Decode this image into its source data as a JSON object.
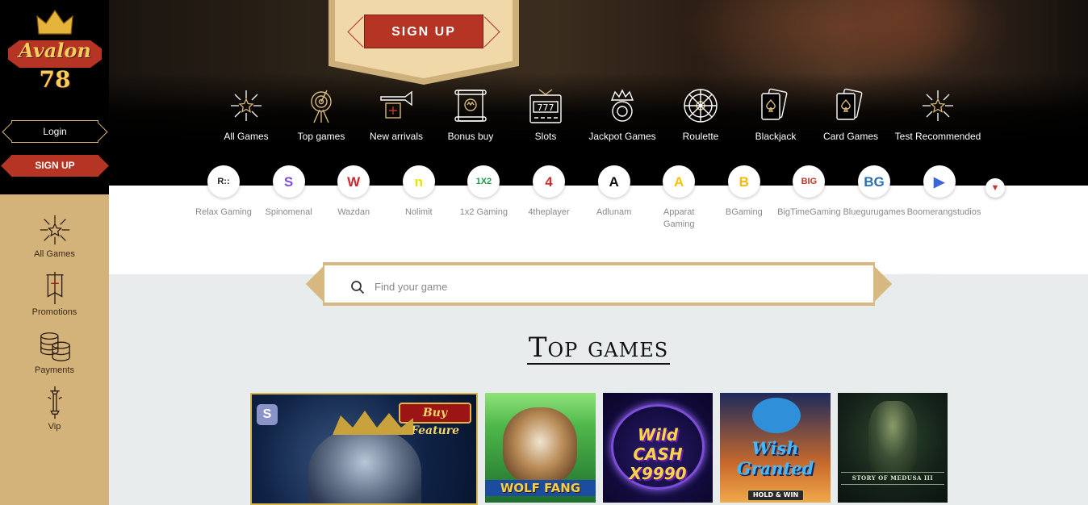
{
  "brand": {
    "name": "Avalon",
    "number": "78"
  },
  "auth": {
    "login_label": "Login",
    "signup_label": "SIGN UP",
    "hero_signup_label": "SIGN UP"
  },
  "sidebar": {
    "items": [
      {
        "label": "All Games",
        "icon": "fireworks-icon"
      },
      {
        "label": "Promotions",
        "icon": "banner-flag-icon"
      },
      {
        "label": "Payments",
        "icon": "coins-icon"
      },
      {
        "label": "Vip",
        "icon": "sword-icon"
      }
    ]
  },
  "categories": [
    {
      "label": "All Games",
      "icon": "fireworks-icon"
    },
    {
      "label": "Top games",
      "icon": "target-icon"
    },
    {
      "label": "New arrivals",
      "icon": "trumpet-icon"
    },
    {
      "label": "Bonus buy",
      "icon": "scroll-icon"
    },
    {
      "label": "Slots",
      "icon": "slot-machine-icon"
    },
    {
      "label": "Jackpot Games",
      "icon": "crown-ring-icon"
    },
    {
      "label": "Roulette",
      "icon": "roulette-icon"
    },
    {
      "label": "Blackjack",
      "icon": "cards-icon"
    },
    {
      "label": "Card Games",
      "icon": "cards-icon"
    },
    {
      "label": "Test Recommended",
      "icon": "fireworks-icon"
    }
  ],
  "providers": [
    {
      "label": "Relax Gaming",
      "mark": "R::",
      "color": "#222222"
    },
    {
      "label": "Spinomenal",
      "mark": "S",
      "color": "#7b4de0"
    },
    {
      "label": "Wazdan",
      "mark": "W",
      "color": "#d0282e"
    },
    {
      "label": "Nolimit",
      "mark": "n",
      "color": "#e6e600"
    },
    {
      "label": "1x2 Gaming",
      "mark": "1X2",
      "color": "#1f9e4a"
    },
    {
      "label": "4theplayer",
      "mark": "4",
      "color": "#d22d2d"
    },
    {
      "label": "Adlunam",
      "mark": "A",
      "color": "#111111"
    },
    {
      "label": "Apparat Gaming",
      "mark": "A",
      "color": "#f5c400"
    },
    {
      "label": "BGaming",
      "mark": "B",
      "color": "#f5b800"
    },
    {
      "label": "BigTimeGaming",
      "mark": "BIG",
      "color": "#c0392b"
    },
    {
      "label": "Bluegurugames",
      "mark": "BG",
      "color": "#2a6fb5"
    },
    {
      "label": "Boomerangstudios",
      "mark": "▶",
      "color": "#3b64d6"
    }
  ],
  "search": {
    "placeholder": "Find your game"
  },
  "section_title": "Top games",
  "games": [
    {
      "title": "Buy Feature",
      "brand": "S"
    },
    {
      "title": "WOLF FANG"
    },
    {
      "title": "Wild CASH X9990"
    },
    {
      "title": "Wish Granted",
      "subtitle": "HOLD & WIN"
    },
    {
      "title": "STORY OF MEDUSA III"
    }
  ],
  "colors": {
    "accent": "#b63424",
    "gold": "#d3b37a",
    "gold_light": "#f0d8a8"
  }
}
